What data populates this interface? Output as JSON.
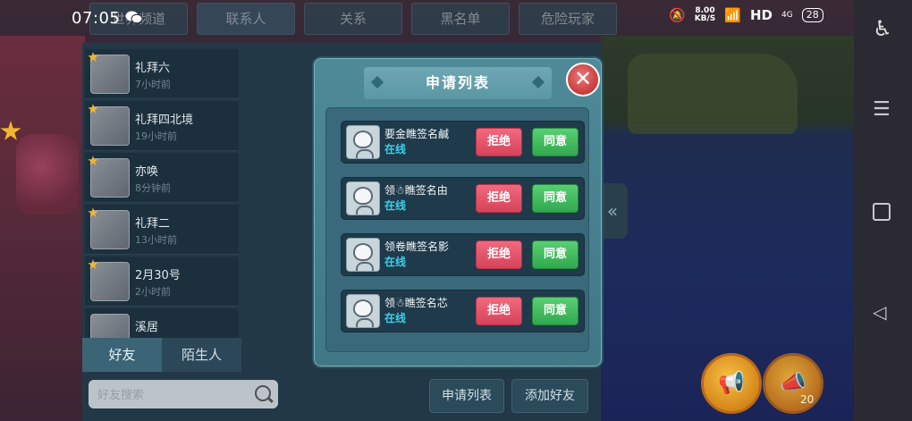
{
  "status_bar": {
    "time": "07:05",
    "net_speed_value": "8.00",
    "net_speed_unit": "KB/S",
    "hd_label": "HD",
    "signal_label": "4G",
    "battery": "28"
  },
  "top_tabs": [
    {
      "label": "世界频道"
    },
    {
      "label": "联系人"
    },
    {
      "label": "关系"
    },
    {
      "label": "黑名单"
    },
    {
      "label": "危险玩家"
    }
  ],
  "friends": [
    {
      "name": "礼拜六",
      "time": "7小时前"
    },
    {
      "name": "礼拜四北境",
      "time": "19小时前"
    },
    {
      "name": "亦唤",
      "time": "8分钟前"
    },
    {
      "name": "礼拜二",
      "time": "13小时前"
    },
    {
      "name": "2月30号",
      "time": "2小时前"
    },
    {
      "name": "溪居",
      "time": ""
    }
  ],
  "bottom_tabs": {
    "friends": "好友",
    "strangers": "陌生人"
  },
  "search": {
    "placeholder": "好友搜索"
  },
  "panel_buttons": {
    "request_list": "申请列表",
    "add_friend": "添加好友"
  },
  "modal": {
    "title": "申请列表",
    "close_symbol": "✕",
    "requests": [
      {
        "name": "要金瞧签名鹹",
        "status": "在线",
        "reject": "拒绝",
        "accept": "同意"
      },
      {
        "name": "领☃瞧签名由",
        "status": "在线",
        "reject": "拒绝",
        "accept": "同意"
      },
      {
        "name": "领卷瞧签名影",
        "status": "在线",
        "reject": "拒绝",
        "accept": "同意"
      },
      {
        "name": "领☃瞧签名芯",
        "status": "在线",
        "reject": "拒绝",
        "accept": "同意"
      }
    ]
  },
  "speaker_count": "20",
  "icons": {
    "side_handle": "«",
    "horn": "📢",
    "speaker": "📣",
    "nav_menu": "☰",
    "nav_back": "◁",
    "accessibility": "♿"
  },
  "colors": {
    "reject": "#d6435a",
    "accept": "#32a84f",
    "online": "#3dd0ea"
  }
}
